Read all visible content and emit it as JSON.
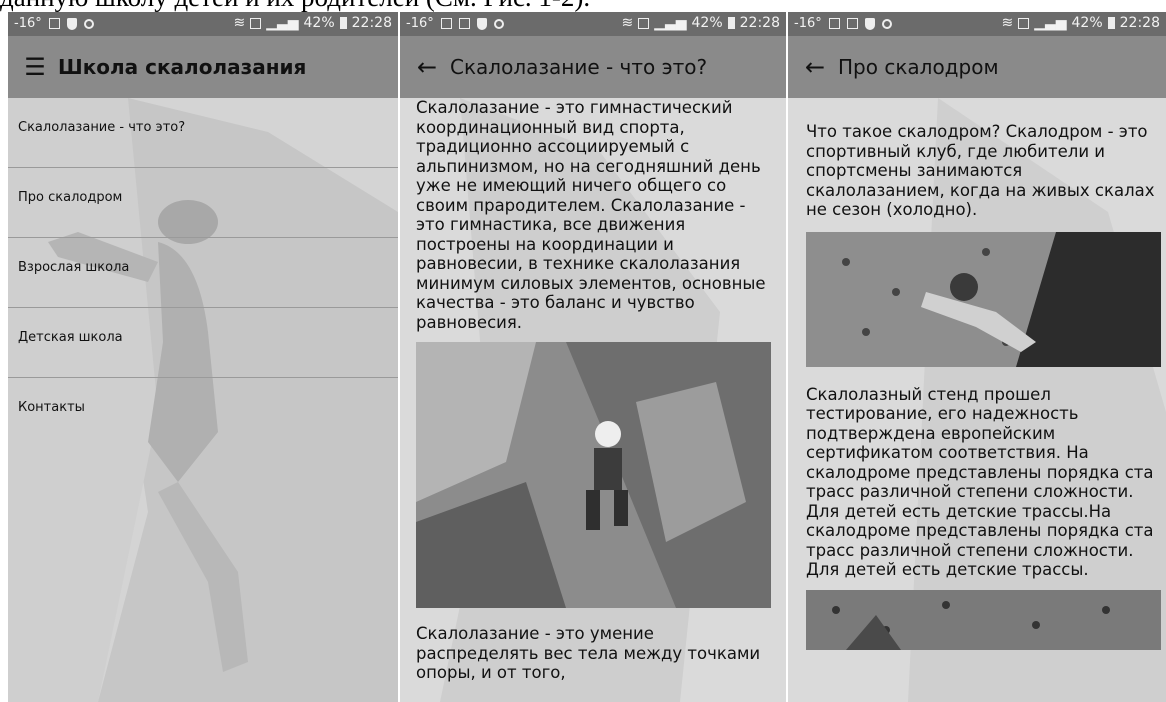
{
  "caption": "данную школу детей и их родителей (См. Рис. 1-2).",
  "status": {
    "temp": "-16°",
    "battery": "42%",
    "time": "22:28"
  },
  "screen1": {
    "toolbar_title": "Школа скалолазания",
    "menu": [
      "Скалолазание - что это?",
      "Про скалодром",
      "Взрослая школа",
      "Детская школа",
      "Контакты"
    ]
  },
  "screen2": {
    "toolbar_title": "Скалолазание - что это?",
    "para1": "Скалолазание - это гимнастический координационный вид спорта, традиционно ассоциируемый с альпинизмом, но на сегодняшний день уже не имеющий ничего общего со своим прародителем. Скалолазание - это гимнастика, все движения построены на координации и равновесии, в технике скалолазания минимум силовых элементов, основные качества - это баланс и чувство равновесия.",
    "para2": "Скалолазание - это умение распределять вес тела между точками опоры, и от того,"
  },
  "screen3": {
    "toolbar_title": "Про скалодром",
    "para1": "Что такое скалодром? Скалодром - это спортивный клуб, где любители и спортсмены занимаются скалолазанием, когда на живых скалах не сезон (холодно).",
    "para2": "Скалолазный стенд прошел тестирование, его надежность подтверждена европейским сертификатом соответствия. На скалодроме представлены порядка ста трасс различной степени сложности. Для детей есть детские трассы.На скалодроме представлены порядка ста трасс различной степени сложности. Для детей есть детские трассы."
  }
}
